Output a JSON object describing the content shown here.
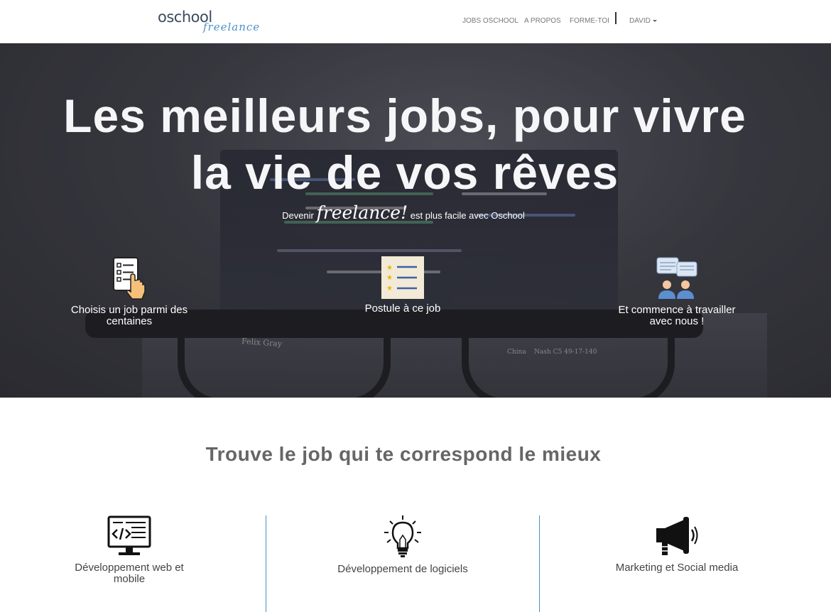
{
  "navbar": {
    "logo_word": "oschool",
    "logo_script": "freelance",
    "links": [
      {
        "label": "JOBS OSCHOOL"
      },
      {
        "label": "A PROPOS"
      },
      {
        "label": "FORME-TOI"
      }
    ],
    "user_label": "DAVID"
  },
  "hero": {
    "title_line1": "Les meilleurs jobs, pour vivre",
    "title_line2": "la vie de vos rêves",
    "subtitle_before": "Devenir",
    "subtitle_script": "freelance!",
    "subtitle_after": "est plus facile avec Oschool",
    "steps": [
      {
        "label": "Choisis un job parmi des centaines",
        "icon": "checklist-hand-icon"
      },
      {
        "label": "Postule à ce job",
        "icon": "star-list-icon"
      },
      {
        "label": "Et commence à travailler avec nous !",
        "icon": "people-chat-icon"
      }
    ]
  },
  "categories": {
    "title": "Trouve le job qui te correspond le mieux",
    "items": [
      {
        "label": "Développement web et mobile",
        "icon": "code-monitor-icon"
      },
      {
        "label": "Développement de logiciels",
        "icon": "lightbulb-icon"
      },
      {
        "label": "Marketing et Social media",
        "icon": "megaphone-icon"
      }
    ]
  },
  "colors": {
    "accent": "#4a8fc4",
    "hero_text": "#f6f6f8",
    "section_title": "#666666"
  }
}
